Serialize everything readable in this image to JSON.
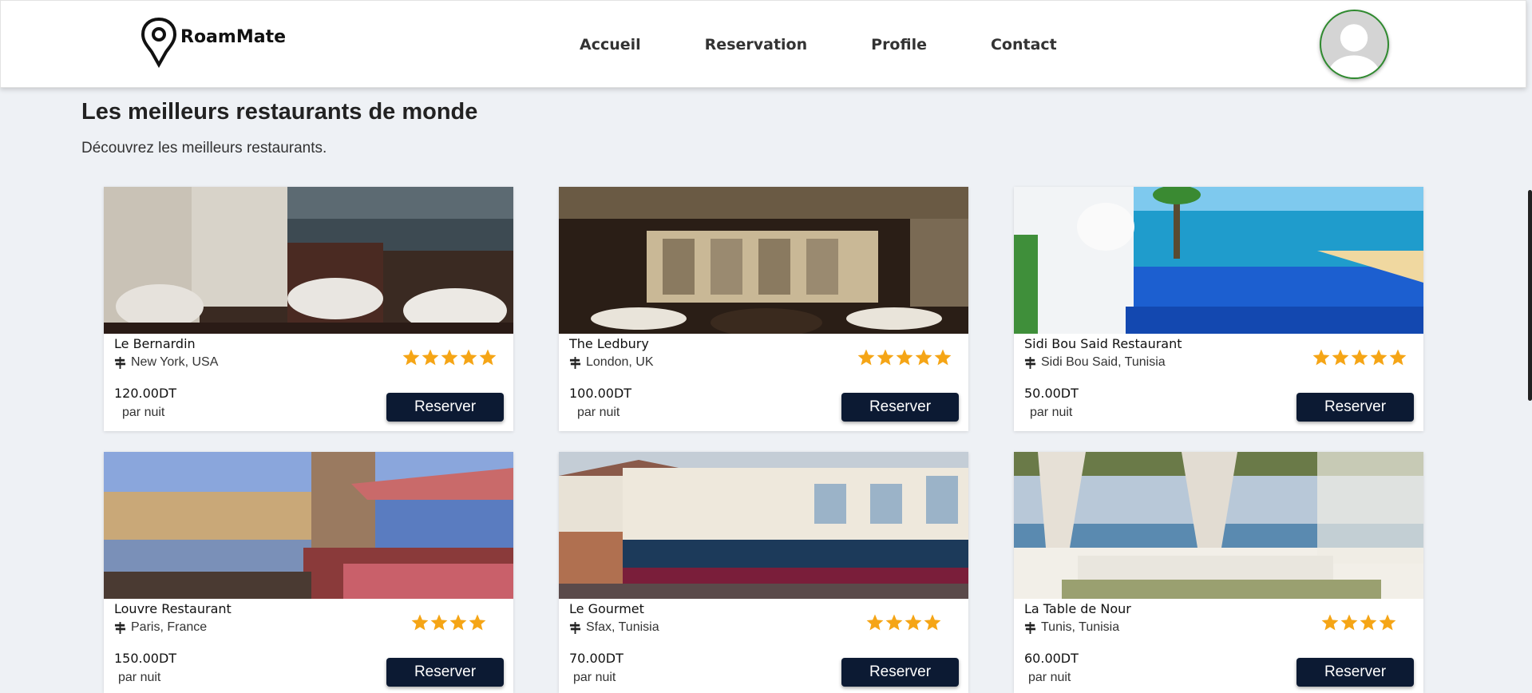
{
  "header": {
    "brand": "RoamMate",
    "nav": [
      "Accueil",
      "Reservation",
      "Profile",
      "Contact"
    ]
  },
  "page": {
    "title": "Les meilleurs restaurants de monde",
    "subtitle": "Découvrez les meilleurs restaurants."
  },
  "cards": [
    {
      "name": "Le Bernardin",
      "location": "New York, USA",
      "price": "120.00DT",
      "unit": "par nuit",
      "rating": 5,
      "button": "Reserver"
    },
    {
      "name": "The Ledbury",
      "location": "London, UK",
      "price": "100.00DT",
      "unit": "par nuit",
      "rating": 5,
      "button": "Reserver"
    },
    {
      "name": "Sidi Bou Said Restaurant",
      "location": "Sidi Bou Said, Tunisia",
      "price": "50.00DT",
      "unit": "par nuit",
      "rating": 5,
      "button": "Reserver"
    },
    {
      "name": "Louvre Restaurant",
      "location": "Paris, France",
      "price": "150.00DT",
      "unit": "par nuit",
      "rating": 4,
      "button": "Reserver"
    },
    {
      "name": "Le Gourmet",
      "location": "Sfax, Tunisia",
      "price": "70.00DT",
      "unit": "par nuit",
      "rating": 4,
      "button": "Reserver"
    },
    {
      "name": "La Table de Nour",
      "location": "Tunis, Tunisia",
      "price": "60.00DT",
      "unit": "par nuit",
      "rating": 4,
      "button": "Reserver"
    }
  ],
  "colors": {
    "star": "#f5a516",
    "button": "#0c1a33",
    "avatar_ring": "#2f8a2f"
  }
}
